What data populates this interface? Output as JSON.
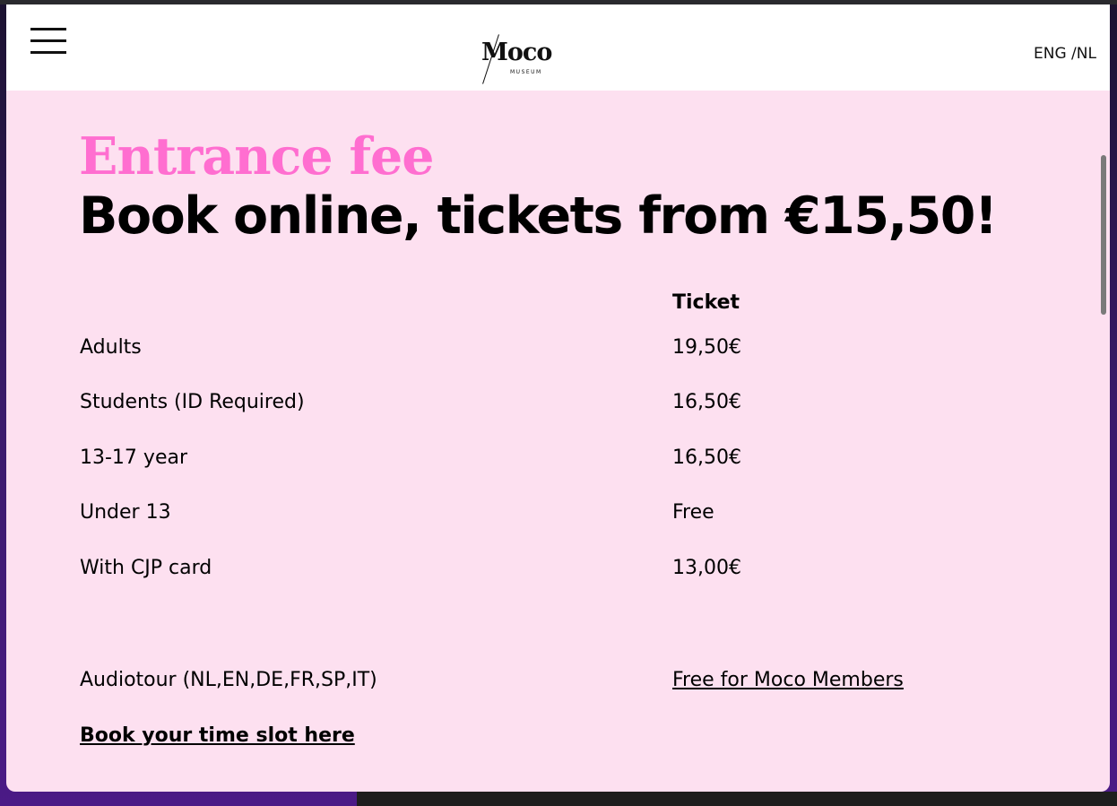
{
  "header": {
    "logo_text": "Moco",
    "logo_subtext": "MUSEUM",
    "language": "ENG /NL"
  },
  "hero": {
    "title_pink": "Entrance fee",
    "title_black": "Book online, tickets from €15,50!"
  },
  "table": {
    "column_header": "Ticket",
    "rows": [
      {
        "label": "Adults",
        "value": "19,50€"
      },
      {
        "label": "Students (ID Required)",
        "value": "16,50€"
      },
      {
        "label": "13-17 year",
        "value": "16,50€"
      },
      {
        "label": "Under 13",
        "value": "Free"
      },
      {
        "label": "With CJP card",
        "value": "13,00€"
      }
    ],
    "audiotour": {
      "label": "Audiotour (NL,EN,DE,FR,SP,IT)",
      "value": "Free for Moco Members"
    }
  },
  "cta": {
    "book_label": "Book your time slot here"
  },
  "colors": {
    "pink_accent": "#ff6ed0",
    "page_bg": "#fde0f0"
  }
}
